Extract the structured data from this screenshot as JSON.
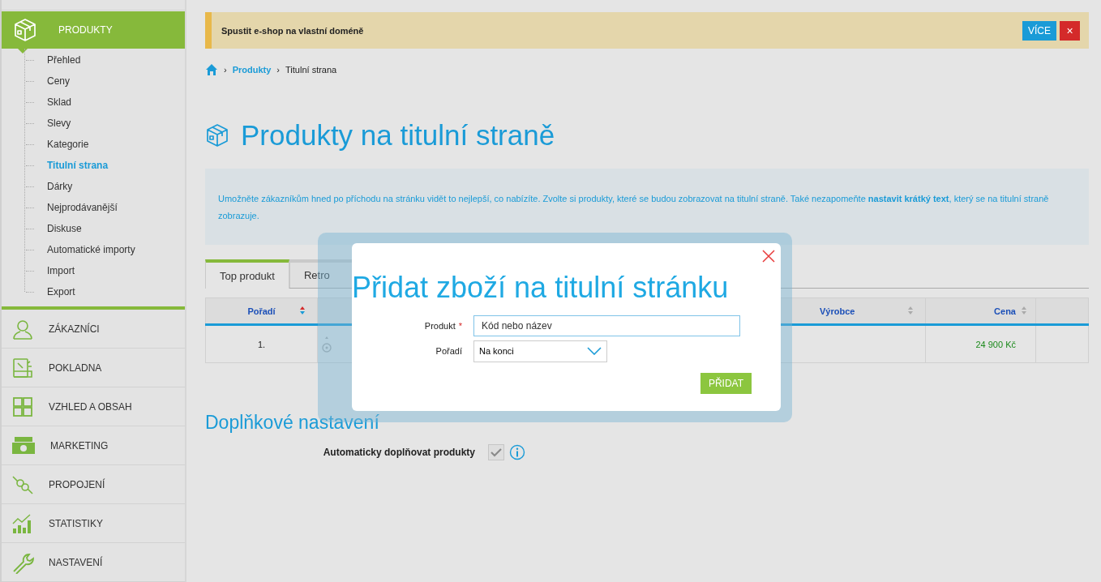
{
  "sidebar": {
    "active_section": {
      "label": "PRODUKTY"
    },
    "subitems": [
      {
        "label": "Přehled",
        "selected": false
      },
      {
        "label": "Ceny",
        "selected": false
      },
      {
        "label": "Sklad",
        "selected": false
      },
      {
        "label": "Slevy",
        "selected": false
      },
      {
        "label": "Kategorie",
        "selected": false
      },
      {
        "label": "Titulní strana",
        "selected": true
      },
      {
        "label": "Dárky",
        "selected": false
      },
      {
        "label": "Nejprodávanější",
        "selected": false
      },
      {
        "label": "Diskuse",
        "selected": false
      },
      {
        "label": "Automatické importy",
        "selected": false
      },
      {
        "label": "Import",
        "selected": false
      },
      {
        "label": "Export",
        "selected": false
      }
    ],
    "sections": [
      {
        "label": "ZÁKAZNÍCI"
      },
      {
        "label": "POKLADNA"
      },
      {
        "label": "VZHLED A OBSAH"
      },
      {
        "label": "MARKETING"
      },
      {
        "label": "PROPOJENÍ"
      },
      {
        "label": "STATISTIKY"
      },
      {
        "label": "NASTAVENÍ"
      }
    ]
  },
  "banner": {
    "text": "Spustit e-shop na vlastní doméně",
    "more_button": "VÍCE",
    "close_button": "×"
  },
  "breadcrumb": [
    {
      "kind": "separator",
      "text": "›"
    },
    {
      "kind": "link",
      "text": "Produkty"
    },
    {
      "kind": "separator",
      "text": "›"
    },
    {
      "kind": "current",
      "text": "Titulní strana"
    }
  ],
  "page_title": "Produkty na titulní straně",
  "info": "Umožněte zákazníkům hned po příchodu na stránku vidět to nejlepší, co nabízíte. Zvolte si produkty, které se budou zobrazovat na titulní straně. Také nezapomeňte **nastavit krátký text**, který se na titulní straně zobrazuje.",
  "tabs": [
    {
      "label": "Top produkt",
      "selected": true
    },
    {
      "label": "Retro",
      "selected": false
    }
  ],
  "table": {
    "columns": [
      {
        "label": "Pořadí",
        "sort_active": true
      },
      {
        "label": "Výrobce",
        "sort_active": false
      },
      {
        "label": "Cena",
        "sort_active": false
      }
    ],
    "rows": [
      {
        "order": "1.",
        "price": "24 900 Kč"
      }
    ]
  },
  "settings": {
    "heading": "Doplňkové nastavení",
    "options": [
      {
        "label": "Automaticky doplňovat produkty",
        "checked": true,
        "disabled": true
      }
    ]
  },
  "modal": {
    "title": "Přidat zboží na titulní stránku",
    "fields": [
      {
        "kind": "text",
        "label": "Produkt",
        "required_mark": "*",
        "placeholder": "Kód nebo název"
      },
      {
        "kind": "select",
        "label": "Pořadí",
        "value": "Na konci"
      }
    ],
    "submit": "PŘIDAT"
  }
}
